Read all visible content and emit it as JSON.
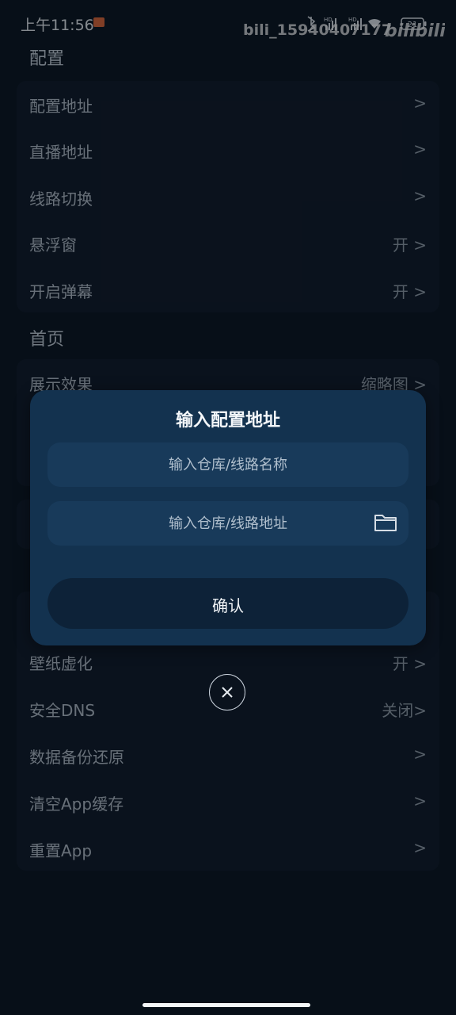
{
  "status_bar": {
    "time": "上午11:56",
    "watermark": "bili_15940407177",
    "battery": "21"
  },
  "sections": {
    "config": {
      "title": "配置",
      "items": [
        {
          "label": "配置地址",
          "value": ">"
        },
        {
          "label": "直播地址",
          "value": ">"
        },
        {
          "label": "线路切换",
          "value": ">"
        },
        {
          "label": "悬浮窗",
          "value": "开 >"
        },
        {
          "label": "开启弹幕",
          "value": "开 >"
        }
      ]
    },
    "home": {
      "title": "首页",
      "items": [
        {
          "label": "展示效果",
          "value": "缩略图 >"
        }
      ]
    },
    "other": {
      "items": [
        {
          "label": "壁纸虚化",
          "value": "开 >"
        },
        {
          "label": "安全DNS",
          "value": "关闭>"
        },
        {
          "label": "数据备份还原",
          "value": ">"
        },
        {
          "label": "清空App缓存",
          "value": ">"
        },
        {
          "label": "重置App",
          "value": ">"
        }
      ]
    }
  },
  "dialog": {
    "title": "输入配置地址",
    "name_placeholder": "输入仓库/线路名称",
    "url_placeholder": "输入仓库/线路地址",
    "confirm_label": "确认"
  },
  "icons": {
    "folder": "folder-icon",
    "close": "close-icon"
  }
}
